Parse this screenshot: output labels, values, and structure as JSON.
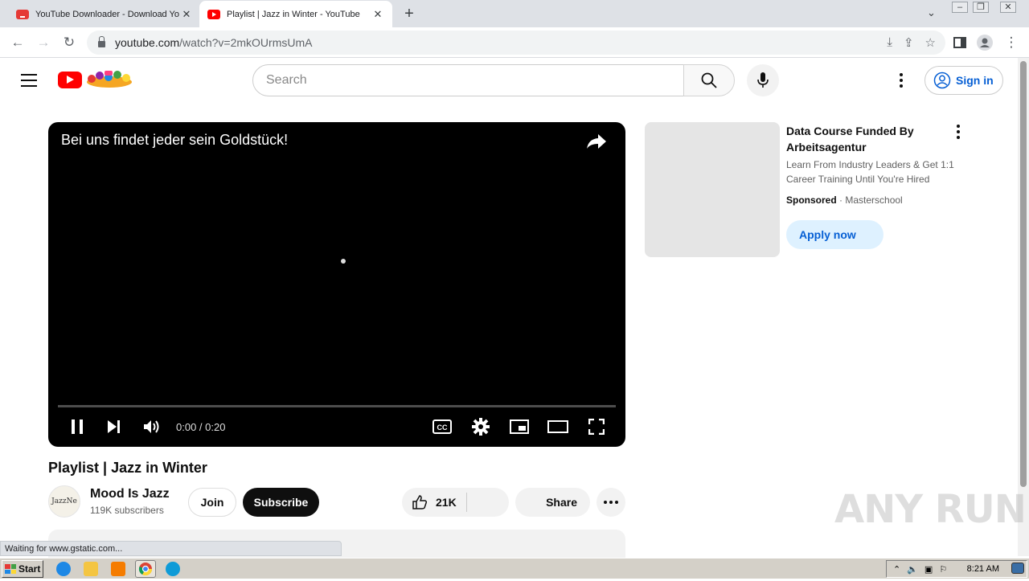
{
  "browser": {
    "tabs": [
      {
        "title": "YouTube Downloader - Download Yo",
        "active": false
      },
      {
        "title": "Playlist | Jazz in Winter - YouTube",
        "active": true
      }
    ],
    "url_host": "youtube.com",
    "url_path": "/watch?v=2mkOUrmsUmA",
    "status_text": "Waiting for www.gstatic.com..."
  },
  "header": {
    "search_placeholder": "Search",
    "signin_label": "Sign in"
  },
  "player": {
    "overlay_title": "Bei uns findet jeder sein Goldstück!",
    "time": "0:00 / 0:20",
    "progress": 0.0
  },
  "video": {
    "title": "Playlist | Jazz in Winter",
    "channel_name": "Mood Is Jazz",
    "channel_avatar_text": "JazzNe",
    "subscribers": "119K subscribers",
    "join_label": "Join",
    "subscribe_label": "Subscribe",
    "likes": "21K",
    "share_label": "Share"
  },
  "ad": {
    "title": "Data Course Funded By Arbeitsagentur",
    "description": "Learn From Industry Leaders & Get 1:1 Career Training Until You're Hired",
    "sponsored_label": "Sponsored",
    "advertiser": "Masterschool",
    "cta_label": "Apply now"
  },
  "watermark": "ANY RUN",
  "taskbar": {
    "start_label": "Start",
    "clock": "8:21 AM"
  },
  "colors": {
    "yt_red": "#ff0000",
    "link_blue": "#065fd4",
    "apply_bg": "#def1ff"
  }
}
